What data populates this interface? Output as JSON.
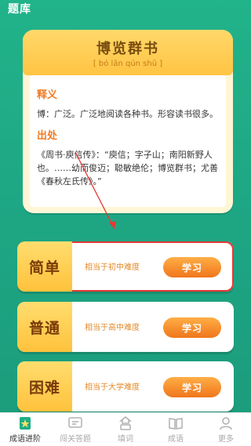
{
  "header": {
    "title": "题库"
  },
  "idiom": {
    "title": "博览群书",
    "pinyin": "[ bó lǎn qún shū ]",
    "meaning_label": "释义",
    "meaning_text": "博：广泛。广泛地阅读各种书。形容读书很多。",
    "source_label": "出处",
    "source_text": "《周书·庾信传》：“庾信；字子山；南阳新野人也。……幼而俊迈；聪敏绝伦；博览群书；尤善《春秋左氏传》。”"
  },
  "levels": [
    {
      "name": "简单",
      "desc": "相当于初中难度",
      "button": "学习"
    },
    {
      "name": "普通",
      "desc": "相当于高中难度",
      "button": "学习"
    },
    {
      "name": "困难",
      "desc": "相当于大学难度",
      "button": "学习"
    }
  ],
  "nav": [
    {
      "label": "成语进阶",
      "icon": "idiom-advance-icon",
      "active": true
    },
    {
      "label": "闯关答题",
      "icon": "quiz-icon",
      "active": false
    },
    {
      "label": "填词",
      "icon": "fill-word-icon",
      "active": false
    },
    {
      "label": "成语",
      "icon": "book-icon",
      "active": false
    },
    {
      "label": "更多",
      "icon": "person-icon",
      "active": false
    }
  ],
  "colors": {
    "background": "#21b38a",
    "accent_orange": "#f07a21",
    "card_yellow": "#ffc443",
    "annotation_red": "#e53935"
  }
}
